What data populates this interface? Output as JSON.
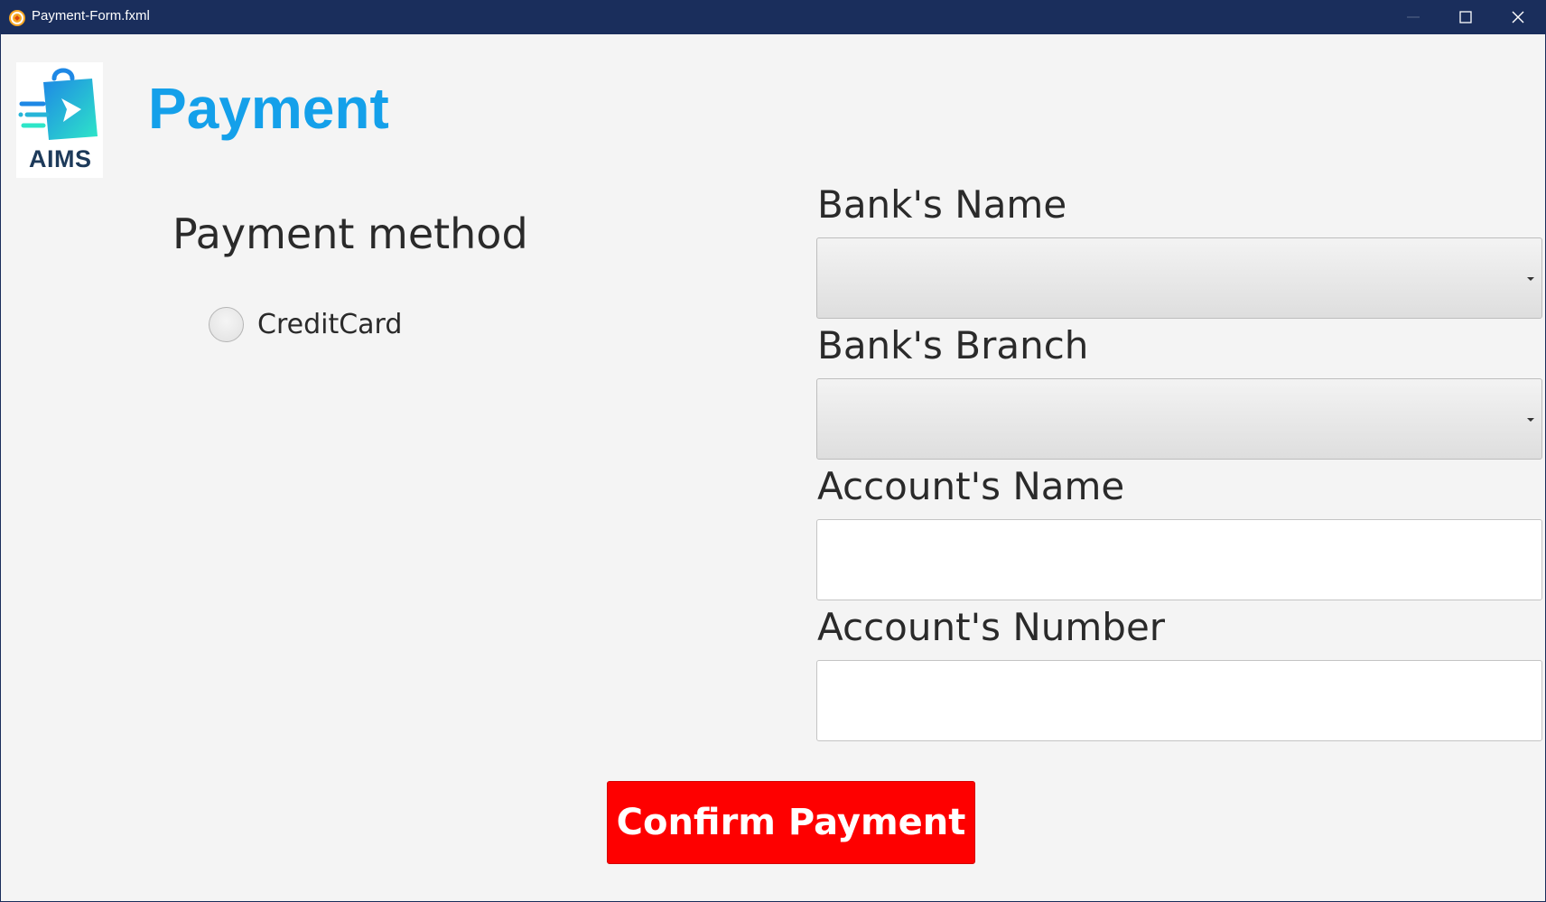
{
  "window": {
    "title": "Payment-Form.fxml",
    "app_icon": "javafx-app-icon",
    "controls": [
      "minimize-icon",
      "maximize-icon",
      "close-icon"
    ]
  },
  "logo": {
    "text": "AIMS",
    "icon": "shopping-bag-arrow-icon"
  },
  "page_title": "Payment",
  "payment_method": {
    "heading": "Payment method",
    "options": [
      {
        "label": "CreditCard",
        "selected": false
      }
    ]
  },
  "form": {
    "bank_name": {
      "label": "Bank's Name",
      "value": ""
    },
    "bank_branch": {
      "label": "Bank's Branch",
      "value": ""
    },
    "account_name": {
      "label": "Account's Name",
      "value": "",
      "placeholder": ""
    },
    "account_number": {
      "label": "Account's Number",
      "value": "",
      "placeholder": ""
    }
  },
  "confirm_button": "Confirm Payment",
  "colors": {
    "titlebar": "#1a2e5c",
    "background": "#f4f4f4",
    "title_accent": "#14a0ea",
    "confirm_button": "#fe0000"
  }
}
